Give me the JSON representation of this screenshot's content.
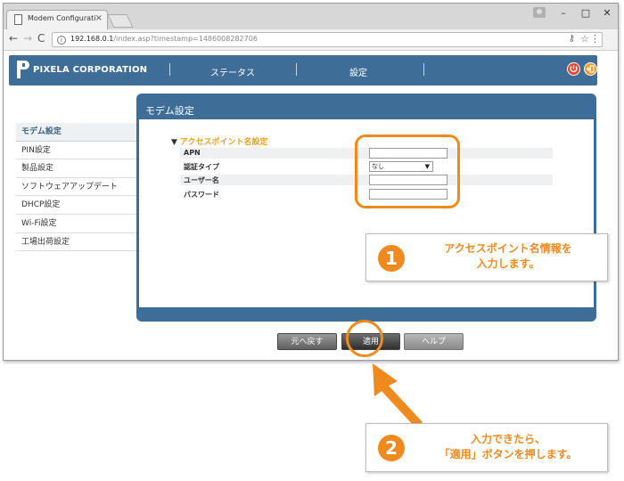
{
  "browser": {
    "tab_title": "Modem Configuration In",
    "tab_close": "×",
    "url_host": "192.168.0.1",
    "url_path": "/index.asp?timestamp=1486008282706",
    "window_minimize": "–",
    "window_maximize": "□",
    "window_close": "✕"
  },
  "header": {
    "brand": "PIXELA CORPORATION",
    "nav_status": "ステータス",
    "nav_settings": "設定"
  },
  "sidebar": {
    "items": [
      {
        "label": "モデム設定"
      },
      {
        "label": "PIN設定"
      },
      {
        "label": "製品設定"
      },
      {
        "label": "ソフトウェアアップデート"
      },
      {
        "label": "DHCP設定"
      },
      {
        "label": "Wi-Fi設定"
      },
      {
        "label": "工場出荷設定"
      }
    ]
  },
  "panel": {
    "title": "モデム設定",
    "section_title": "アクセスポイント名設定",
    "fields": {
      "apn_label": "APN",
      "apn_value": "",
      "auth_label": "認証タイプ",
      "auth_value": "なし",
      "user_label": "ユーザー名",
      "user_value": "",
      "pass_label": "パスワード",
      "pass_value": ""
    }
  },
  "buttons": {
    "back": "元へ戻す",
    "apply": "適用",
    "help": "ヘルプ"
  },
  "callouts": {
    "one_number": "1",
    "one_line1": "アクセスポイント名情報を",
    "one_line2": "入力します。",
    "two_number": "2",
    "two_line1": "入力できたら、",
    "two_line2": "「適用」ボタンを押します。"
  },
  "colors": {
    "brand_blue": "#3e6e97",
    "accent_orange": "#ef8a1f"
  }
}
